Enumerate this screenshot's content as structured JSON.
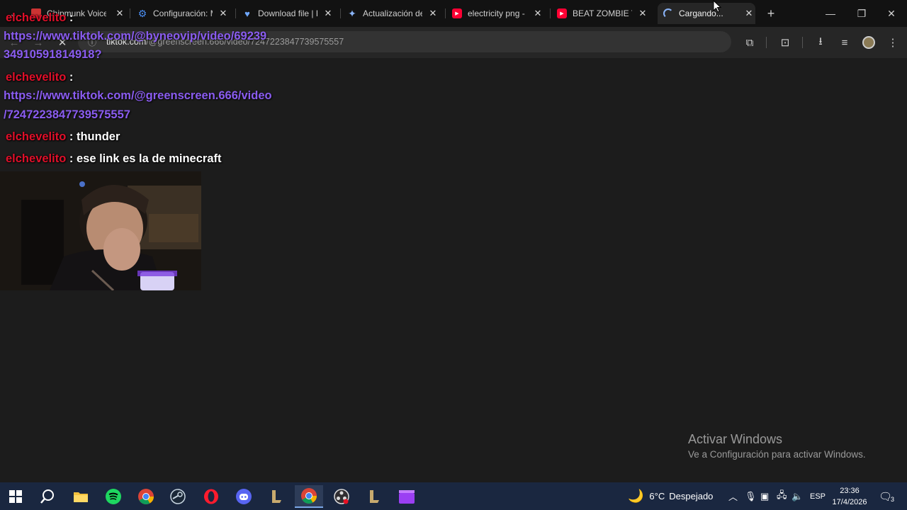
{
  "browser": {
    "tabs": [
      {
        "title": "Chipmunk Voice",
        "favicon": "audio-icon",
        "color": "#e0e0e0"
      },
      {
        "title": "Configuración: M",
        "favicon": "gear-icon",
        "color": "#4a8df0"
      },
      {
        "title": "Download file | P",
        "favicon": "heart-icon",
        "color": "#6fa8ff"
      },
      {
        "title": "Actualización de",
        "favicon": "sparkle-icon",
        "color": "#8ab4f8"
      },
      {
        "title": "electricity png -",
        "favicon": "youtube-icon",
        "color": "#ff0033"
      },
      {
        "title": "BEAT ZOMBIE TS",
        "favicon": "youtube-icon",
        "color": "#ff0033"
      },
      {
        "title": "Cargando...",
        "favicon": "loading-icon",
        "color": "#8ab4f8"
      }
    ],
    "address": {
      "host": "tiktok.com",
      "path": "/@greenscreen.666/video/7247223847739575557"
    }
  },
  "chat": {
    "messages": [
      {
        "user": "elchevelito",
        "sep": ":",
        "text": ""
      },
      {
        "link_line1": "https://www.tiktok.com/@byneovip/video/69239",
        "link_line2": "34910591814918?"
      },
      {
        "user": "elchevelito",
        "sep": ":",
        "text": ""
      },
      {
        "link_line1": "https://www.tiktok.com/@greenscreen.666/video",
        "link_line2": "/7247223847739575557"
      },
      {
        "user": "elchevelito",
        "sep": ":",
        "text": "thunder"
      },
      {
        "user": "elchevelito",
        "sep": ":",
        "text": "ese link es la de minecraft"
      }
    ]
  },
  "watermark": {
    "title": "Activar Windows",
    "subtitle": "Ve a Configuración para activar Windows."
  },
  "taskbar": {
    "weather": {
      "temp": "6°C",
      "condition": "Despejado"
    },
    "language": "ESP",
    "time": "23:36",
    "date": "17/4/2026",
    "notifications": "3"
  },
  "colors": {
    "username": "#e0102a",
    "link": "#8a5cf0",
    "taskbar": "#1a2740"
  }
}
